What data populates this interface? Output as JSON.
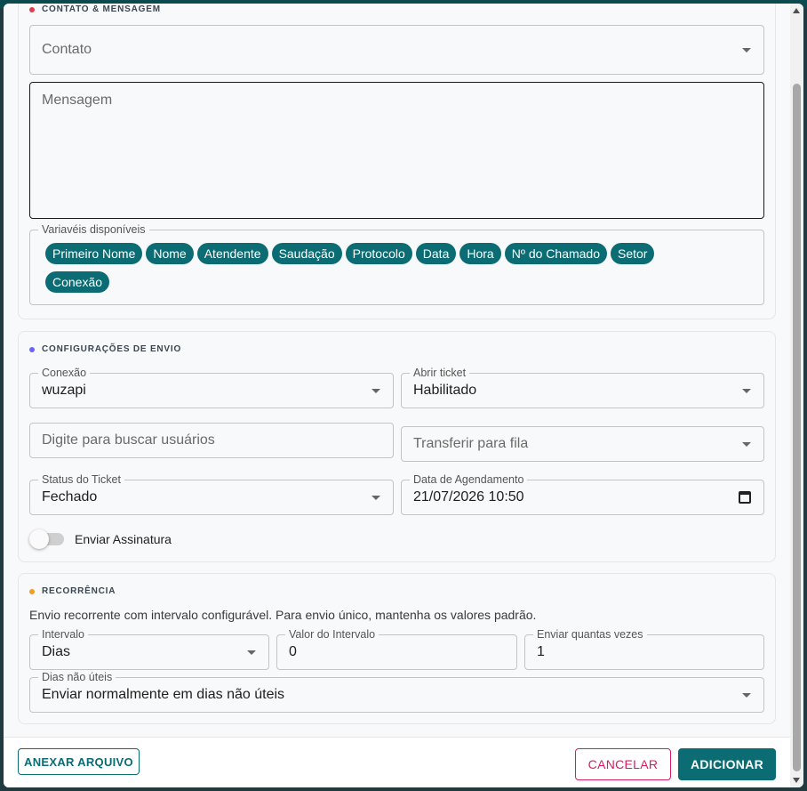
{
  "sections": {
    "contact": {
      "title": "CONTATO & MENSAGEM",
      "dot_color": "#e53950",
      "contact_label": "Contato",
      "message_label": "Mensagem",
      "variables_label": "Variavéis disponíveis",
      "variables": [
        "Primeiro Nome",
        "Nome",
        "Atendente",
        "Saudação",
        "Protocolo",
        "Data",
        "Hora",
        "Nº do Chamado",
        "Setor",
        "Conexão"
      ]
    },
    "settings": {
      "title": "CONFIGURAÇÕES DE ENVIO",
      "dot_color": "#6c63ff",
      "connection_label": "Conexão",
      "connection_value": "wuzapi",
      "open_ticket_label": "Abrir ticket",
      "open_ticket_value": "Habilitado",
      "user_search_placeholder": "Digite para buscar usuários",
      "queue_placeholder": "Transferir para fila",
      "ticket_status_label": "Status do Ticket",
      "ticket_status_value": "Fechado",
      "schedule_label": "Data de Agendamento",
      "schedule_value": "21/07/2026 10:50",
      "signature_label": "Enviar Assinatura",
      "signature_enabled": false
    },
    "recurrence": {
      "title": "RECORRÊNCIA",
      "dot_color": "#f29d1c",
      "helper": "Envio recorrente com intervalo configurável. Para envio único, mantenha os valores padrão.",
      "interval_label": "Intervalo",
      "interval_value": "Dias",
      "interval_value_label": "Valor do Intervalo",
      "interval_value_value": "0",
      "times_label": "Enviar quantas vezes",
      "times_value": "1",
      "nonbusiness_label": "Dias não úteis",
      "nonbusiness_value": "Enviar normalmente em dias não úteis"
    }
  },
  "footer": {
    "attach_label": "ANEXAR ARQUIVO",
    "cancel_label": "CANCELAR",
    "add_label": "ADICIONAR"
  },
  "colors": {
    "primary": "#0b6c73",
    "cancel": "#d81b60"
  }
}
